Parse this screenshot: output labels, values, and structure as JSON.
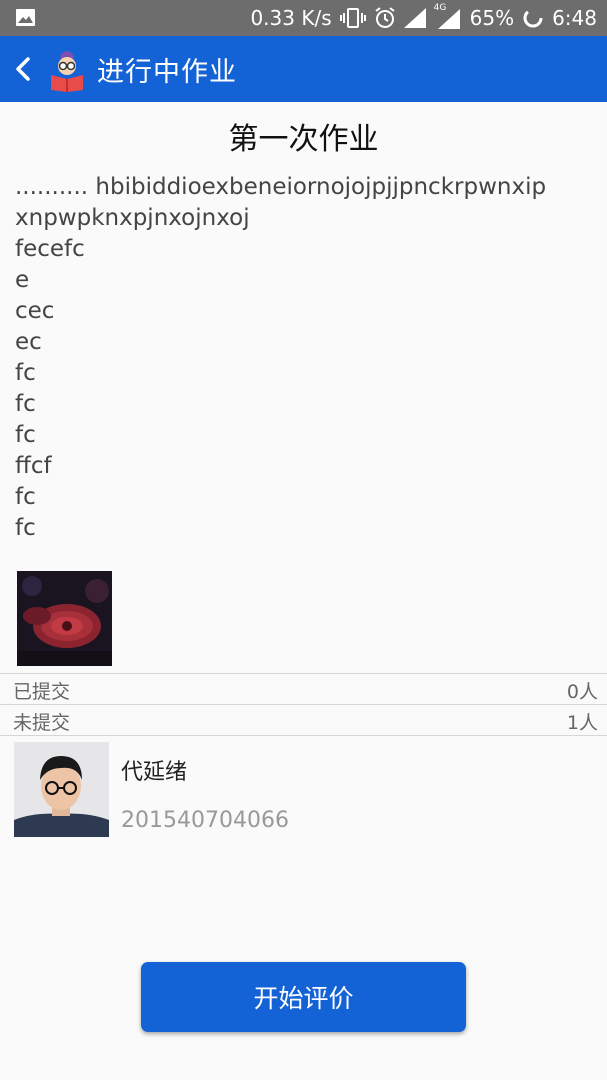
{
  "status_bar": {
    "speed": "0.33 K/s",
    "network": "4G",
    "battery": "65%",
    "time": "6:48"
  },
  "app_bar": {
    "title": "进行中作业"
  },
  "homework": {
    "title": "第一次作业",
    "lines": [
      ".......... hbibiddioexbeneiornojojpjjpnckrpwnxip",
      "xnpwpknxpjnxojnxoj",
      "fecefc",
      "e",
      "cec",
      "ec",
      "fc",
      "fc",
      "fc",
      "ffcf",
      "fc",
      "fc"
    ]
  },
  "submitted": {
    "label": "已提交",
    "count": "0人"
  },
  "not_submitted": {
    "label": "未提交",
    "count": "1人"
  },
  "student": {
    "name": "代延绪",
    "id": "201540704066"
  },
  "action_button": {
    "label": "开始评价"
  }
}
